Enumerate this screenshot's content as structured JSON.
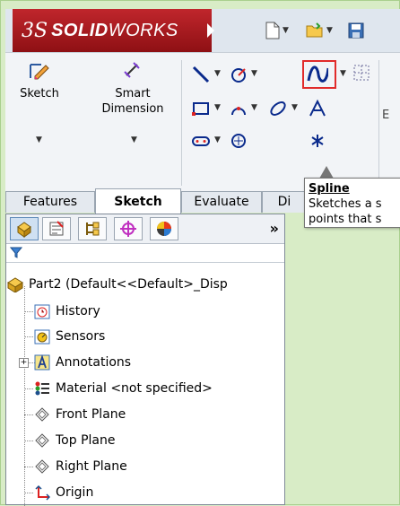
{
  "app": {
    "logo_mark": "3S",
    "brand_bold": "SOLID",
    "brand_light": "WORKS"
  },
  "ribbon": {
    "sketch_label": "Sketch",
    "smart_dimension_line1": "Smart",
    "smart_dimension_line2": "Dimension",
    "partial_label": "E"
  },
  "tabs": [
    {
      "label": "Features"
    },
    {
      "label": "Sketch"
    },
    {
      "label": "Evaluate"
    },
    {
      "label": "Di"
    }
  ],
  "tooltip": {
    "title": "Spline",
    "line1": "Sketches a s",
    "line2": "points that s"
  },
  "tree": {
    "more_label": "»",
    "part_label": "Part2  (Default<<Default>_Disp",
    "items": [
      {
        "label": "History"
      },
      {
        "label": "Sensors"
      },
      {
        "label": "Annotations"
      },
      {
        "label": "Material <not specified>"
      },
      {
        "label": "Front Plane"
      },
      {
        "label": "Top Plane"
      },
      {
        "label": "Right Plane"
      },
      {
        "label": "Origin"
      }
    ]
  }
}
